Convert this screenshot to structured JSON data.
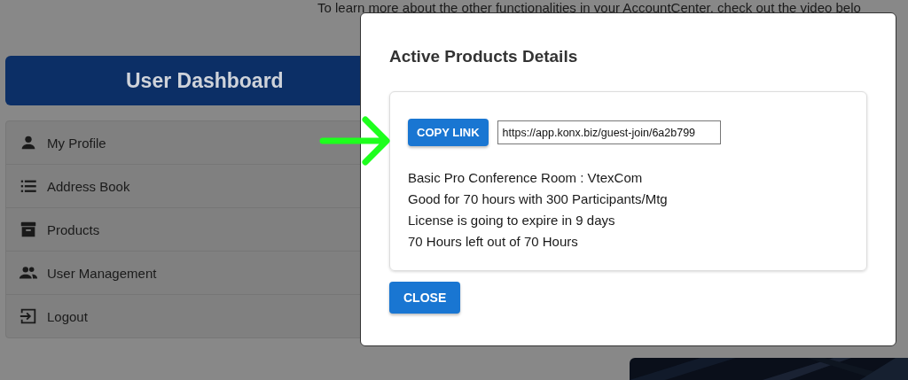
{
  "intro_text": "To learn more about the other functionalities in your AccountCenter, check out the video belo",
  "dashboard": {
    "title": "User Dashboard"
  },
  "menu": [
    {
      "label": "My Profile"
    },
    {
      "label": "Address Book"
    },
    {
      "label": "Products"
    },
    {
      "label": "User Management"
    },
    {
      "label": "Logout"
    }
  ],
  "modal": {
    "title": "Active Products Details",
    "copy_button": "COPY LINK",
    "link": {
      "value": "https://app.konx.biz/guest-join/6a2b799"
    },
    "details": [
      "Basic Pro Conference Room : VtexCom",
      "Good for 70 hours with 300 Participants/Mtg",
      "License is going to expire in 9 days",
      "70 Hours left out of 70 Hours"
    ],
    "close_button": "CLOSE"
  }
}
